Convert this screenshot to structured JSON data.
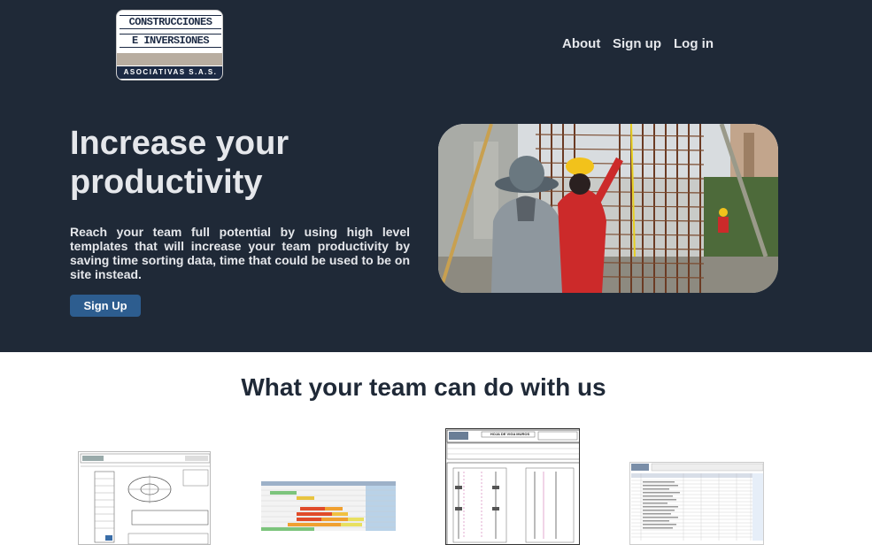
{
  "header": {
    "logo": {
      "line1": "CONSTRUCCIONES",
      "line2": "E INVERSIONES",
      "line3": "ASOCIATIVAS S.A.S."
    },
    "nav": [
      {
        "label": "About"
      },
      {
        "label": "Sign up"
      },
      {
        "label": "Log in"
      }
    ]
  },
  "hero": {
    "title": "Increase your productivity",
    "description": "Reach your team full potential by using high level templates that will increase your team productivity by saving time sorting data, time that could be used to be on site instead.",
    "cta_label": "Sign Up",
    "image": "construction workers tying rebar column cage"
  },
  "features": {
    "title": "What your team can do with us",
    "thumbnails": [
      {
        "name": "structural-drawing-template"
      },
      {
        "name": "progress-schedule-spreadsheet"
      },
      {
        "name": "beam-sheet-template",
        "header": "HOJA DE VIGA MUROS"
      },
      {
        "name": "quantities-spreadsheet"
      }
    ]
  },
  "colors": {
    "hero_bg": "#1f2937",
    "button": "#2d5d8f",
    "text_light": "#e5e7eb"
  }
}
